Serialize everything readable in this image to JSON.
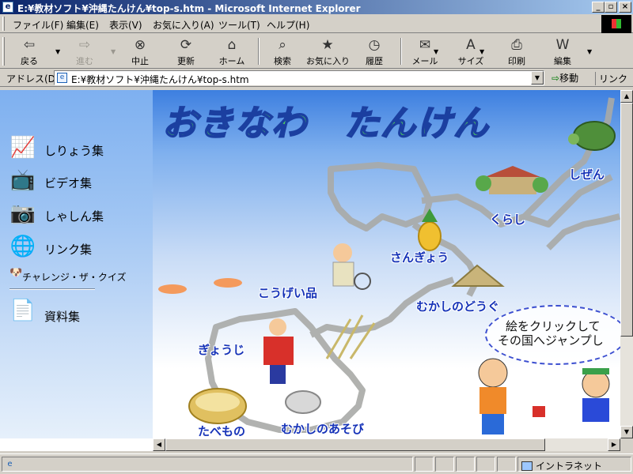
{
  "window": {
    "title": "E:¥教材ソフト¥沖縄たんけん¥top-s.htm - Microsoft Internet Explorer",
    "minimize": "_",
    "maximize": "▫",
    "close": "×"
  },
  "menu": [
    "ファイル(F)",
    "編集(E)",
    "表示(V)",
    "お気に入り(A)",
    "ツール(T)",
    "ヘルプ(H)"
  ],
  "toolbar": {
    "back": "戻る",
    "forward": "進む",
    "stop": "中止",
    "refresh": "更新",
    "home": "ホーム",
    "search": "検索",
    "favorites": "お気に入り",
    "history": "履歴",
    "mail": "メール",
    "size": "サイズ",
    "print": "印刷",
    "edit": "編集"
  },
  "address": {
    "label": "アドレス(D)",
    "value": "E:¥教材ソフト¥沖縄たんけん¥top-s.htm",
    "go": "移動",
    "links": "リンク"
  },
  "nav": {
    "data": "しりょう集",
    "video": "ビデオ集",
    "photo": "しゃしん集",
    "links": "リンク集",
    "quiz": "チャレンジ・ザ・クイズ",
    "materials": "資料集"
  },
  "map": {
    "title": "おきなわ　たんけん",
    "labels": {
      "nature": "しぜん",
      "life": "くらし",
      "industry": "さんぎょう",
      "craft": "こうげい品",
      "old_tools": "むかしのどうぐ",
      "fishing": "ぎょうじ",
      "food": "たべもの",
      "old_play": "むかしのあそび"
    },
    "bubble_line1": "絵をクリックして",
    "bubble_line2": "その国へジャンプし"
  },
  "status": {
    "text": "",
    "zone": "イントラネット"
  },
  "colors": {
    "title_fill": "#4fd35a",
    "title_outline": "#1b3fa0",
    "map_label": "#1633b8",
    "titlebar_start": "#0a246a",
    "titlebar_end": "#a6caf0"
  },
  "icons": {
    "back": "back-arrow-icon",
    "forward": "forward-arrow-icon",
    "stop": "stop-icon",
    "refresh": "refresh-icon",
    "home": "home-icon",
    "search": "search-icon",
    "favorites": "favorites-icon",
    "history": "history-icon",
    "mail": "mail-icon",
    "size": "font-size-icon",
    "print": "print-icon",
    "edit": "edit-icon"
  }
}
